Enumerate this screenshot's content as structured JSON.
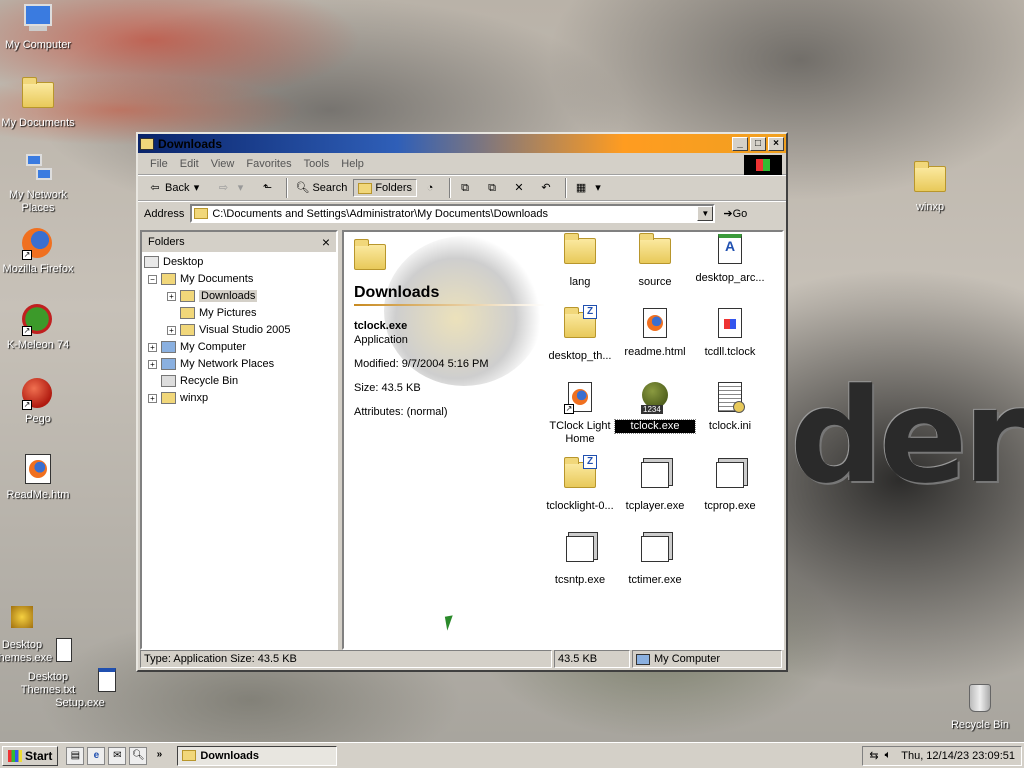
{
  "desktop": {
    "icons": [
      {
        "label": "My Computer"
      },
      {
        "label": "My Documents"
      },
      {
        "label": "My Network Places"
      },
      {
        "label": "Mozilla Firefox"
      },
      {
        "label": "K-Meleon 74"
      },
      {
        "label": "Pego"
      },
      {
        "label": "ReadMe.htm"
      },
      {
        "label": "Desktop Themes.exe"
      },
      {
        "label": "Desktop Themes.txt"
      },
      {
        "label": "Setup.exe"
      },
      {
        "label": "winxp"
      },
      {
        "label": "Recycle Bin"
      }
    ],
    "wallpaper_text": "der"
  },
  "window": {
    "title": "Downloads",
    "menu": [
      "File",
      "Edit",
      "View",
      "Favorites",
      "Tools",
      "Help"
    ],
    "toolbar": {
      "back": "Back",
      "search": "Search",
      "folders": "Folders"
    },
    "address": {
      "label": "Address",
      "value": "C:\\Documents and Settings\\Administrator\\My Documents\\Downloads",
      "go": "Go"
    },
    "folders_pane": {
      "title": "Folders",
      "close": "×",
      "nodes": [
        {
          "label": "Desktop",
          "toggle": ""
        },
        {
          "label": "My Documents",
          "toggle": "−"
        },
        {
          "label": "Downloads",
          "toggle": "+"
        },
        {
          "label": "My Pictures",
          "toggle": ""
        },
        {
          "label": "Visual Studio 2005",
          "toggle": "+"
        },
        {
          "label": "My Computer",
          "toggle": "+"
        },
        {
          "label": "My Network Places",
          "toggle": "+"
        },
        {
          "label": "Recycle Bin",
          "toggle": ""
        },
        {
          "label": "winxp",
          "toggle": "+"
        }
      ]
    },
    "info": {
      "heading": "Downloads",
      "filename": "tclock.exe",
      "type": "Application",
      "modified": "Modified: 9/7/2004 5:16 PM",
      "size": "Size: 43.5 KB",
      "attributes": "Attributes: (normal)"
    },
    "files": [
      {
        "label": "lang",
        "kind": "folder"
      },
      {
        "label": "source",
        "kind": "folder"
      },
      {
        "label": "desktop_arc...",
        "kind": "archive"
      },
      {
        "label": "desktop_th...",
        "kind": "zip"
      },
      {
        "label": "readme.html",
        "kind": "html"
      },
      {
        "label": "tcdll.tclock",
        "kind": "doc"
      },
      {
        "label": "TClock Light Home",
        "kind": "link"
      },
      {
        "label": "tclock.exe",
        "kind": "app"
      },
      {
        "label": "tclock.ini",
        "kind": "ini"
      },
      {
        "label": "tclocklight-0...",
        "kind": "zip"
      },
      {
        "label": "tcplayer.exe",
        "kind": "exe"
      },
      {
        "label": "tcprop.exe",
        "kind": "exe"
      },
      {
        "label": "tcsntp.exe",
        "kind": "exe"
      },
      {
        "label": "tctimer.exe",
        "kind": "exe"
      }
    ],
    "status": {
      "type": "Type: Application Size: 43.5 KB",
      "size": "43.5 KB",
      "zone": "My Computer"
    }
  },
  "taskbar": {
    "start": "Start",
    "chevron": "»",
    "task": "Downloads",
    "clock": "Thu, 12/14/23 23:09:51"
  }
}
